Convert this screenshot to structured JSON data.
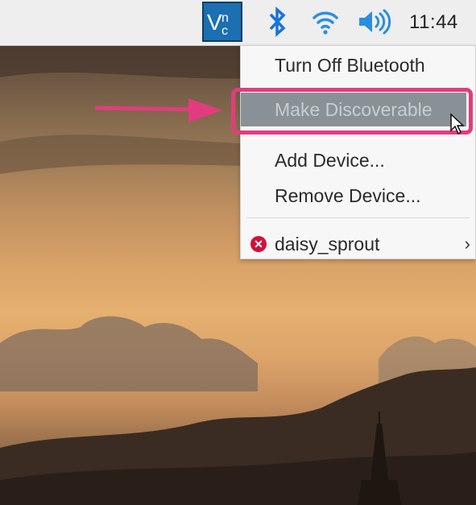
{
  "taskbar": {
    "clock": "11:44",
    "icons": [
      "vnc-icon",
      "bluetooth-icon",
      "wifi-icon",
      "volume-icon"
    ]
  },
  "bluetooth_menu": {
    "items": [
      {
        "label": "Turn Off Bluetooth",
        "state": "normal"
      },
      {
        "label": "Make Discoverable",
        "state": "highlighted"
      },
      {
        "label": "Add Device...",
        "state": "normal"
      },
      {
        "label": "Remove Device...",
        "state": "normal"
      }
    ],
    "devices": [
      {
        "label": "daisy_sprout",
        "status": "disconnected",
        "has_submenu": true
      }
    ]
  },
  "annotation": {
    "color": "#e13d7e",
    "target": "Make Discoverable"
  },
  "colors": {
    "taskbar_bg": "#eeeeee",
    "menu_bg": "#f7f7f7",
    "highlight_bg": "#8a9196",
    "bluetooth_blue": "#1a73d9",
    "vnc_blue": "#1c6fb0",
    "disconnected_red": "#d0103a"
  }
}
